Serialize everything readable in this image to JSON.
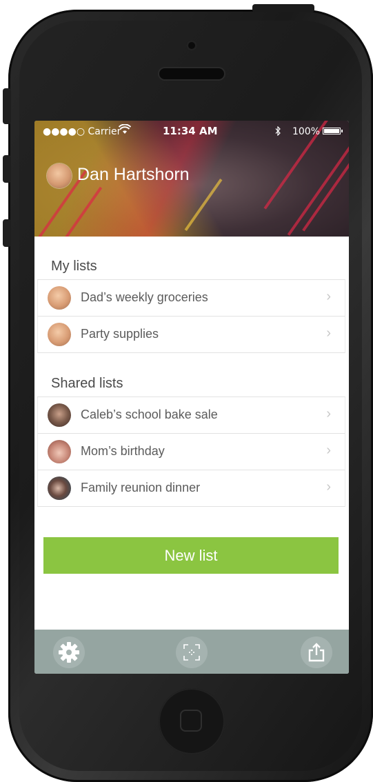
{
  "status_bar": {
    "signal": "●●●●○ Carrier",
    "time": "11:34 AM",
    "battery": "100%",
    "bluetooth_icon": "bluetooth-icon",
    "wifi_icon": "wifi-icon"
  },
  "profile": {
    "name": "Dan Hartshorn",
    "avatar_icon": "user-avatar"
  },
  "my_lists": {
    "title": "My lists",
    "items": [
      {
        "label": "Dad’s weekly groceries",
        "avatar_color": "#d9a07a"
      },
      {
        "label": "Party supplies",
        "avatar_color": "#d9a07a"
      }
    ]
  },
  "shared_lists": {
    "title": "Shared lists",
    "items": [
      {
        "label": "Caleb’s school bake sale",
        "avatar_color": "#7a5a4a"
      },
      {
        "label": "Mom’s birthday",
        "avatar_color": "#c98a7a"
      },
      {
        "label": "Family reunion dinner",
        "avatar_color": "#4a3a35"
      }
    ]
  },
  "chevron": "›",
  "new_list_button": "New list",
  "toolbar": {
    "settings_icon": "gear-icon",
    "scan_icon": "scan-icon",
    "share_icon": "share-icon"
  },
  "colors": {
    "accent_green": "#8bc541",
    "toolbar_bg": "#95a5a1"
  }
}
